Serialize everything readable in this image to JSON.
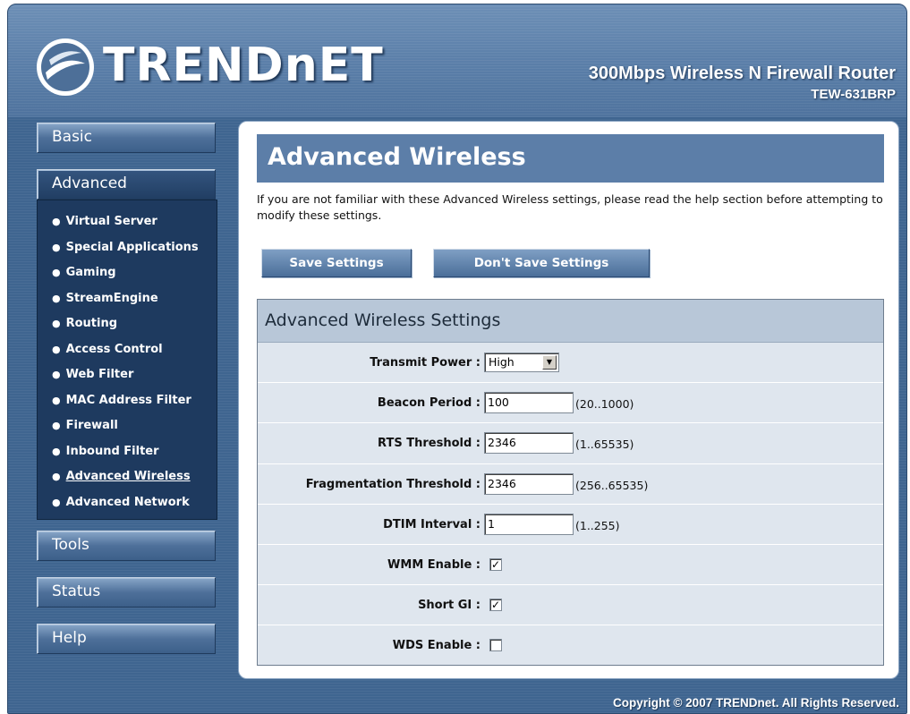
{
  "header": {
    "brand": "TRENDnET",
    "product_title": "300Mbps Wireless N Firewall Router",
    "model": "TEW-631BRP"
  },
  "sidebar": {
    "basic": "Basic",
    "advanced": "Advanced",
    "items": [
      {
        "label": "Virtual Server"
      },
      {
        "label": "Special Applications"
      },
      {
        "label": "Gaming"
      },
      {
        "label": "StreamEngine"
      },
      {
        "label": "Routing"
      },
      {
        "label": "Access Control"
      },
      {
        "label": "Web Filter"
      },
      {
        "label": "MAC Address Filter"
      },
      {
        "label": "Firewall"
      },
      {
        "label": "Inbound Filter"
      },
      {
        "label": "Advanced Wireless"
      },
      {
        "label": "Advanced Network"
      }
    ],
    "tools": "Tools",
    "status": "Status",
    "help": "Help"
  },
  "main": {
    "title": "Advanced Wireless",
    "intro": "If you are not familiar with these Advanced Wireless settings, please read the help section before attempting to modify these settings.",
    "save_label": "Save Settings",
    "dont_save_label": "Don't Save Settings",
    "settings_title": "Advanced Wireless Settings",
    "transmit_power_label": "Transmit Power :",
    "transmit_power_value": "High",
    "beacon_period_label": "Beacon Period :",
    "beacon_period_value": "100",
    "beacon_period_range": "(20..1000)",
    "rts_label": "RTS Threshold :",
    "rts_value": "2346",
    "rts_range": "(1..65535)",
    "frag_label": "Fragmentation Threshold :",
    "frag_value": "2346",
    "frag_range": "(256..65535)",
    "dtim_label": "DTIM Interval :",
    "dtim_value": "1",
    "dtim_range": "(1..255)",
    "wmm_label": "WMM Enable :",
    "wmm_checked": true,
    "short_gi_label": "Short GI :",
    "short_gi_checked": true,
    "wds_label": "WDS Enable :",
    "wds_checked": false
  },
  "footer": {
    "copyright": "Copyright © 2007 TRENDnet. All Rights Reserved."
  },
  "colors": {
    "frame": "#3f6590",
    "title_bar": "#5c7ea8",
    "settings_bg": "#dfe6ee",
    "settings_head": "#b8c7d8",
    "submenu_bg": "#1e3a5f"
  }
}
